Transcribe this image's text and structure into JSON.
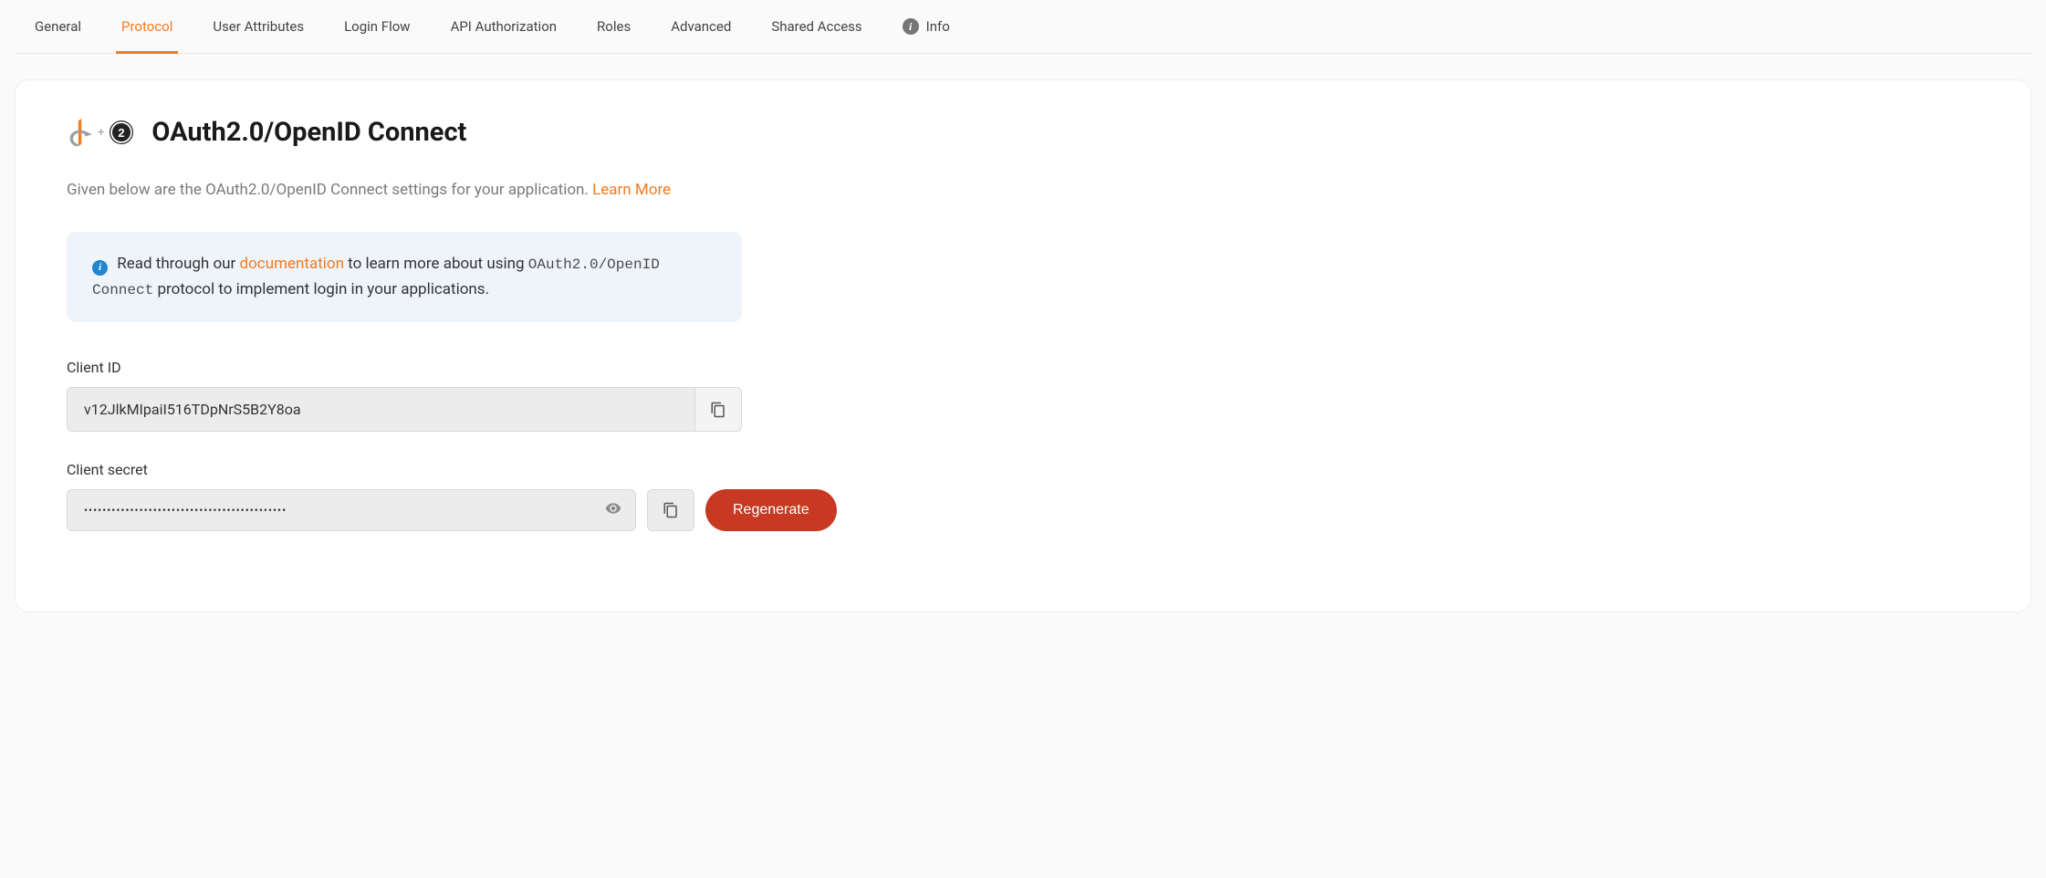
{
  "tabs": {
    "items": [
      {
        "label": "General",
        "name": "tab-general"
      },
      {
        "label": "Protocol",
        "name": "tab-protocol",
        "active": true
      },
      {
        "label": "User Attributes",
        "name": "tab-user-attributes"
      },
      {
        "label": "Login Flow",
        "name": "tab-login-flow"
      },
      {
        "label": "API Authorization",
        "name": "tab-api-authorization"
      },
      {
        "label": "Roles",
        "name": "tab-roles"
      },
      {
        "label": "Advanced",
        "name": "tab-advanced"
      },
      {
        "label": "Shared Access",
        "name": "tab-shared-access"
      },
      {
        "label": "Info",
        "name": "tab-info",
        "icon": "info"
      }
    ]
  },
  "card": {
    "title": "OAuth2.0/OpenID Connect",
    "description_prefix": "Given below are the OAuth2.0/OpenID Connect settings for your application. ",
    "learn_more": "Learn More",
    "banner": {
      "prefix": " Read through our ",
      "documentation_link": "documentation",
      "mid": " to learn more about using ",
      "code": "OAuth2.0/OpenID Connect",
      "suffix": " protocol to implement login in your applications."
    },
    "client_id": {
      "label": "Client ID",
      "value": "v12JlkMIpaiI516TDpNrS5B2Y8oa"
    },
    "client_secret": {
      "label": "Client secret",
      "value": "••••••••••••••••••••••••••••••••••••••••••••",
      "regenerate_label": "Regenerate"
    }
  }
}
